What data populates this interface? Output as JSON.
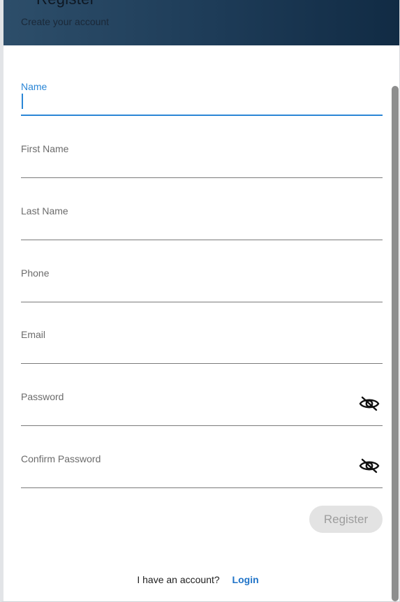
{
  "header": {
    "title": "Register",
    "subtitle": "Create your account"
  },
  "form": {
    "fields": [
      {
        "label": "Name",
        "value": "",
        "focused": true
      },
      {
        "label": "First Name",
        "value": ""
      },
      {
        "label": "Last Name",
        "value": ""
      },
      {
        "label": "Phone",
        "value": ""
      },
      {
        "label": "Email",
        "value": ""
      },
      {
        "label": "Password",
        "value": "",
        "icon": "eye-off-icon"
      },
      {
        "label": "Confirm Password",
        "value": "",
        "icon": "eye-off-icon"
      }
    ],
    "register_label": "Register"
  },
  "footer": {
    "text": "I have an account?",
    "link": "Login"
  },
  "colors": {
    "accent": "#2a86d6",
    "link": "#1f73c8",
    "header_start": "#2d4e6a",
    "header_end": "#112b44",
    "button_bg": "#e3e3e3",
    "button_text": "#9d9d9d"
  }
}
